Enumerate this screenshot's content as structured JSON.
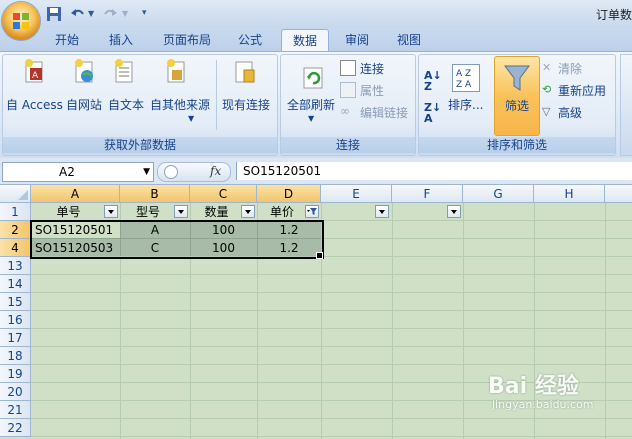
{
  "window": {
    "title": "订单数"
  },
  "qat": {
    "save": "save-icon",
    "undo": "undo-icon",
    "redo": "redo-icon"
  },
  "tabs": [
    {
      "label": "开始"
    },
    {
      "label": "插入"
    },
    {
      "label": "页面布局"
    },
    {
      "label": "公式"
    },
    {
      "label": "数据",
      "active": true
    },
    {
      "label": "审阅"
    },
    {
      "label": "视图"
    }
  ],
  "ribbon": {
    "external": {
      "label": "获取外部数据",
      "buttons": [
        "自 Access",
        "自网站",
        "自文本",
        "自其他来源",
        "现有连接"
      ]
    },
    "connections": {
      "label": "连接",
      "refresh_all": "全部刷新",
      "connections": "连接",
      "properties": "属性",
      "edit_links": "编辑链接"
    },
    "sort_filter": {
      "label": "排序和筛选",
      "sort": "排序...",
      "filter": "筛选",
      "clear": "清除",
      "reapply": "重新应用",
      "advanced": "高级"
    }
  },
  "formula_bar": {
    "name_box": "A2",
    "fx": "fx",
    "content": "SO15120501"
  },
  "columns": [
    "A",
    "B",
    "C",
    "D",
    "E",
    "F",
    "G",
    "H"
  ],
  "rows": [
    "1",
    "2",
    "4",
    "13",
    "14",
    "15",
    "16",
    "17",
    "18",
    "19",
    "20",
    "21",
    "22"
  ],
  "table": {
    "headers": [
      "单号",
      "型号",
      "数量",
      "单价"
    ],
    "data": [
      [
        "SO15120501",
        "A",
        "100",
        "1.2"
      ],
      [
        "SO15120503",
        "C",
        "100",
        "1.2"
      ]
    ]
  },
  "watermark": {
    "text": "Bai 经验",
    "url": "jingyan.baidu.com"
  },
  "colors": {
    "grid_bg": "#cfe0c7",
    "selection": "#a8bba8",
    "ribbon_accent": "#f7b54a"
  }
}
